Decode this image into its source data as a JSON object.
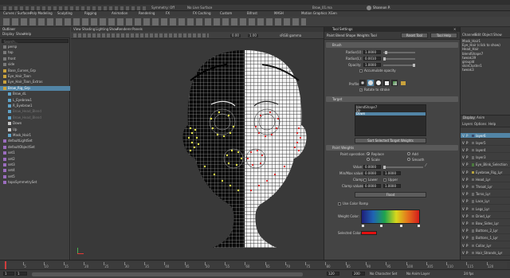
{
  "top": {
    "menus": [
      "Curves / Surfaces",
      "Poly Modeling",
      "Sculpting",
      "Rigging",
      "Animation",
      "Rendering",
      "FX",
      "FX Caching",
      "Custom",
      "Bifrost",
      "MASH",
      "Motion Graphics",
      "XGen"
    ],
    "status_items": [
      "Symmetry: Off",
      "No Live Surface",
      "Brow_01.ma"
    ],
    "shelf_tabs": [
      "Curves / Surfaces",
      "Poly Modeling",
      "Sculpting",
      "Rigging",
      "Animation",
      "Rendering",
      "FX",
      "FX Caching",
      "Custom",
      "Bifrost",
      "MASH",
      "Motion Graphics",
      "XGen"
    ],
    "active_shelf_tab": "Custom_Poly",
    "user": "Shannon P."
  },
  "outliner": {
    "title": "Outliner",
    "menus": [
      "Display",
      "Show",
      "Help"
    ],
    "search_placeholder": "Search...",
    "items": [
      {
        "label": "persp",
        "type": "camera"
      },
      {
        "label": "top",
        "type": "camera"
      },
      {
        "label": "front",
        "type": "camera"
      },
      {
        "label": "side",
        "type": "camera"
      },
      {
        "label": "Base_Curves_Grp",
        "type": "group"
      },
      {
        "label": "Eye_Hair_Toon",
        "type": "group"
      },
      {
        "label": "Eye_Hair_Toon_Extras",
        "type": "group"
      },
      {
        "label": "Brow_Rig_Grp",
        "type": "group",
        "selected": true
      },
      {
        "label": "Brow_dL",
        "type": "mesh"
      },
      {
        "label": "L_Eyebrow1",
        "type": "mesh"
      },
      {
        "label": "R_Eyebrow1",
        "type": "mesh"
      },
      {
        "label": "Brow_Head_Blend",
        "type": "mesh",
        "hidden": true
      },
      {
        "label": "Brow_Head_Blend",
        "type": "mesh",
        "hidden": true
      },
      {
        "label": "Down",
        "type": "locator"
      },
      {
        "label": "Up",
        "type": "locator"
      },
      {
        "label": "Mask_Hair1",
        "type": "mesh"
      },
      {
        "label": "defaultLightSet",
        "type": "set"
      },
      {
        "label": "defaultObjectSet",
        "type": "set"
      },
      {
        "label": "set1",
        "type": "set"
      },
      {
        "label": "set2",
        "type": "set"
      },
      {
        "label": "set3",
        "type": "set"
      },
      {
        "label": "set4",
        "type": "set"
      },
      {
        "label": "set5",
        "type": "set"
      },
      {
        "label": "topoSymmetrySet",
        "type": "set"
      }
    ]
  },
  "viewport": {
    "menus": [
      "View",
      "Shading",
      "Lighting",
      "Show",
      "Renderer",
      "Panels"
    ],
    "colorspace": "sRGB gamma",
    "values": [
      "0.00",
      "1.00"
    ]
  },
  "tool_settings": {
    "title": "Tool Settings",
    "tool_name": "Paint Blend Shape Weights Tool",
    "reset_label": "Reset Tool",
    "help_label": "Tool Help",
    "brush": {
      "header": "Brush",
      "radius_u_label": "Radius(U):",
      "radius_u": "1.0000",
      "radius_l_label": "Radius(L):",
      "radius_l": "0.0010",
      "opacity_label": "Opacity:",
      "opacity": "1.0000",
      "accumulate_label": "Accumulate opacity",
      "profile_label": "Profile:",
      "rotate_label": "Rotate to stroke"
    },
    "target": {
      "header": "Target",
      "items": [
        "blendShape7",
        "Up",
        "Down"
      ],
      "selected_index": 2,
      "button": "Sort Selected Target Weights"
    },
    "paint_weights": {
      "header": "Paint Weights",
      "paint_operation_label": "Paint operation:",
      "operations": [
        "Replace",
        "Add",
        "Scale",
        "Smooth"
      ],
      "selected_operation": "Replace",
      "value_label": "Value:",
      "value": "0.0000",
      "min_label": "Min/Max value:",
      "min_value": "0.0000",
      "max_value": "1.0000",
      "clamp_label": "Clamp:",
      "clamp_lower": "Lower",
      "clamp_upper": "Upper",
      "clamp_values_label": "Clamp values:",
      "clamp_min": "0.0000",
      "clamp_max": "1.0000",
      "flood_label": "Flood"
    },
    "color_ramp": {
      "use_ramp_label": "Use Color Ramp",
      "weight_color_label": "Weight Color:",
      "selected_color_label": "Selected Color:",
      "selected_color": "#e31010"
    }
  },
  "right_panel": {
    "tabs": [
      "Channels",
      "Edit",
      "Object",
      "Show"
    ],
    "menus": [
      "Channels",
      "Edit",
      "Object",
      "Show"
    ],
    "history": [
      "Mask_Hair1",
      "Eye_Hair (click to show)",
      "Head_Hair",
      "blendShape7",
      "tweak39",
      "groupId",
      "skinCluster1",
      "tweak3"
    ],
    "layer_tabs": [
      "Display",
      "Anim"
    ],
    "layer_menus": [
      "Layers",
      "Options",
      "Help"
    ],
    "layers": [
      {
        "name": "layer6",
        "color": "#3b4c6e",
        "selected": true
      },
      {
        "name": "layer5",
        "color": "#6b6b6b"
      },
      {
        "name": "layer4",
        "color": "#6b6b6b"
      },
      {
        "name": "layer3",
        "color": "#6b6b6b"
      },
      {
        "name": "Eye_Blink_Selection",
        "color": "#4a7a3c"
      },
      {
        "name": "Eyebrow_Rig_Lyr",
        "color": "#b8a43c"
      },
      {
        "name": "Head_Lyr",
        "color": "#6b6b6b"
      },
      {
        "name": "Throat_Lyr",
        "color": "#6b6b6b"
      },
      {
        "name": "Torso_Lyr",
        "color": "#6b6b6b"
      },
      {
        "name": "Lace_Lyr",
        "color": "#6b6b6b"
      },
      {
        "name": "Legs_Lyr",
        "color": "#6b6b6b"
      },
      {
        "name": "Dried_Lyr",
        "color": "#6b6b6b"
      },
      {
        "name": "Bow_Sides_Lyr",
        "color": "#6b6b6b"
      },
      {
        "name": "Buttons_2_Lyr",
        "color": "#6b6b6b"
      },
      {
        "name": "Buttons_1_Lyr",
        "color": "#6b6b6b"
      },
      {
        "name": "Collar_Lyr",
        "color": "#6b6b6b"
      },
      {
        "name": "Hair_Strands_Lyr",
        "color": "#6b6b6b"
      }
    ]
  },
  "timeline": {
    "ticks": [
      "5",
      "10",
      "15",
      "20",
      "25",
      "30",
      "35",
      "40",
      "45",
      "50",
      "55",
      "60",
      "65",
      "70",
      "75",
      "80",
      "85",
      "90",
      "95",
      "100",
      "105",
      "110",
      "115",
      "120"
    ],
    "current_frame": "1"
  },
  "range": {
    "start": "1",
    "start2": "1",
    "end": "120",
    "end2": "200",
    "max_end": "120",
    "character_set": "No Character Set",
    "anim_layer": "No Anim Layer",
    "fps": "24 fps"
  }
}
